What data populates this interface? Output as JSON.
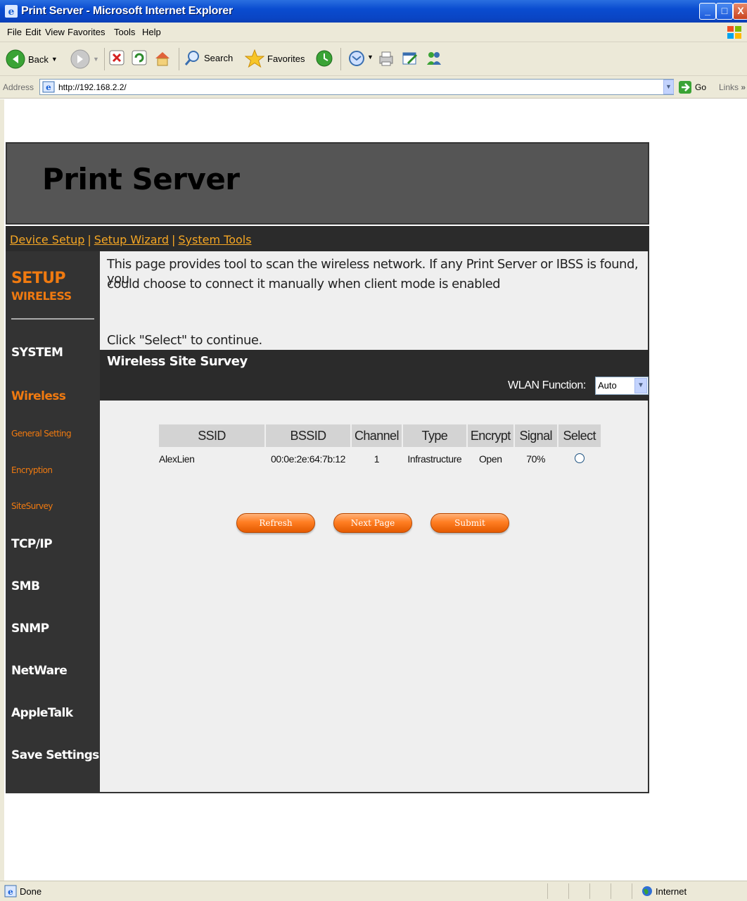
{
  "window": {
    "title": "Print Server - Microsoft Internet Explorer",
    "buttons": {
      "min": "_",
      "max": "□",
      "close": "X"
    }
  },
  "menu": [
    "File",
    "Edit",
    "View",
    "Favorites",
    "Tools",
    "Help"
  ],
  "toolbar": {
    "back": "Back",
    "search": "Search",
    "favorites": "Favorites"
  },
  "address": {
    "label": "Address",
    "url": "http://192.168.2.2/",
    "go": "Go",
    "links": "Links",
    "links_more": "»"
  },
  "page": {
    "title": "Print Server",
    "topnav": [
      "Device Setup",
      "Setup Wizard",
      "System Tools"
    ],
    "topnav_sep": "|",
    "sidebar": {
      "section": "SETUP",
      "subsection": "WIRELESS",
      "items": [
        "SYSTEM",
        "Wireless",
        "General Setting",
        "Encryption",
        "SiteSurvey",
        "TCP/IP",
        "SMB",
        "SNMP",
        "NetWare",
        "AppleTalk",
        "Save Settings"
      ]
    },
    "description_line1": "This page provides tool to scan the wireless network. If any Print Server or IBSS is found, you",
    "description_line2": "could choose to connect it manually when client mode is enabled",
    "instruction": "Click \"Select\" to continue.",
    "survey_title": "Wireless Site Survey",
    "wlan_function_label": "WLAN Function:",
    "wlan_function_value": "Auto",
    "table": {
      "headers": [
        "SSID",
        "BSSID",
        "Channel",
        "Type",
        "Encrypt",
        "Signal",
        "Select"
      ],
      "rows": [
        [
          "AlexLien",
          "00:0e:2e:64:7b:12",
          "1",
          "Infrastructure",
          "Open",
          "70%"
        ]
      ]
    },
    "buttons": {
      "refresh": "Refresh",
      "next_page": "Next Page",
      "submit": "Submit"
    }
  },
  "status": {
    "left": "Done",
    "zone": "Internet"
  },
  "colors": {
    "accent_orange": "#f5a623",
    "dark": "#2b2b2b",
    "xp_blue": "#0a4cd0"
  }
}
